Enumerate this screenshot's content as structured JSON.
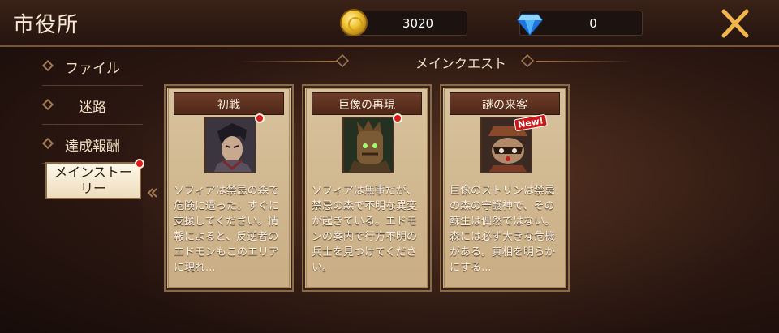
{
  "header": {
    "title": "市役所",
    "gold_amount": "3020",
    "gem_amount": "0",
    "close_icon": "close-x-icon"
  },
  "section": {
    "title": "メインクエスト"
  },
  "sidebar": {
    "items": [
      {
        "label": "ファイル"
      },
      {
        "label": "迷路"
      },
      {
        "label": "達成報酬"
      },
      {
        "label": "メインストーリー"
      }
    ]
  },
  "quests": [
    {
      "title": "初戦",
      "description": "ソフィアは禁忌の森で危険に遭った。すぐに支援してください。情報によると、反逆者のエドモンもこのエリアに現れ...",
      "has_notification": true
    },
    {
      "title": "巨像の再現",
      "description": "ソフィアは無事だが、禁忌の森で不明な異変が起きている。エドモンの案内で行方不明の兵士を見つけてください。",
      "has_notification": true
    },
    {
      "title": "謎の来客",
      "description": "巨像のストリンは禁忌の森の守護神で、その蘇生は偶然ではない。森には必ず大きな危機がある。真相を明らかにする...",
      "badge": "New!"
    }
  ],
  "colors": {
    "accent_gold": "#f0c431",
    "gem_blue": "#2f9bff",
    "notify_red": "#e01818",
    "close_orange": "#f2b64a"
  }
}
